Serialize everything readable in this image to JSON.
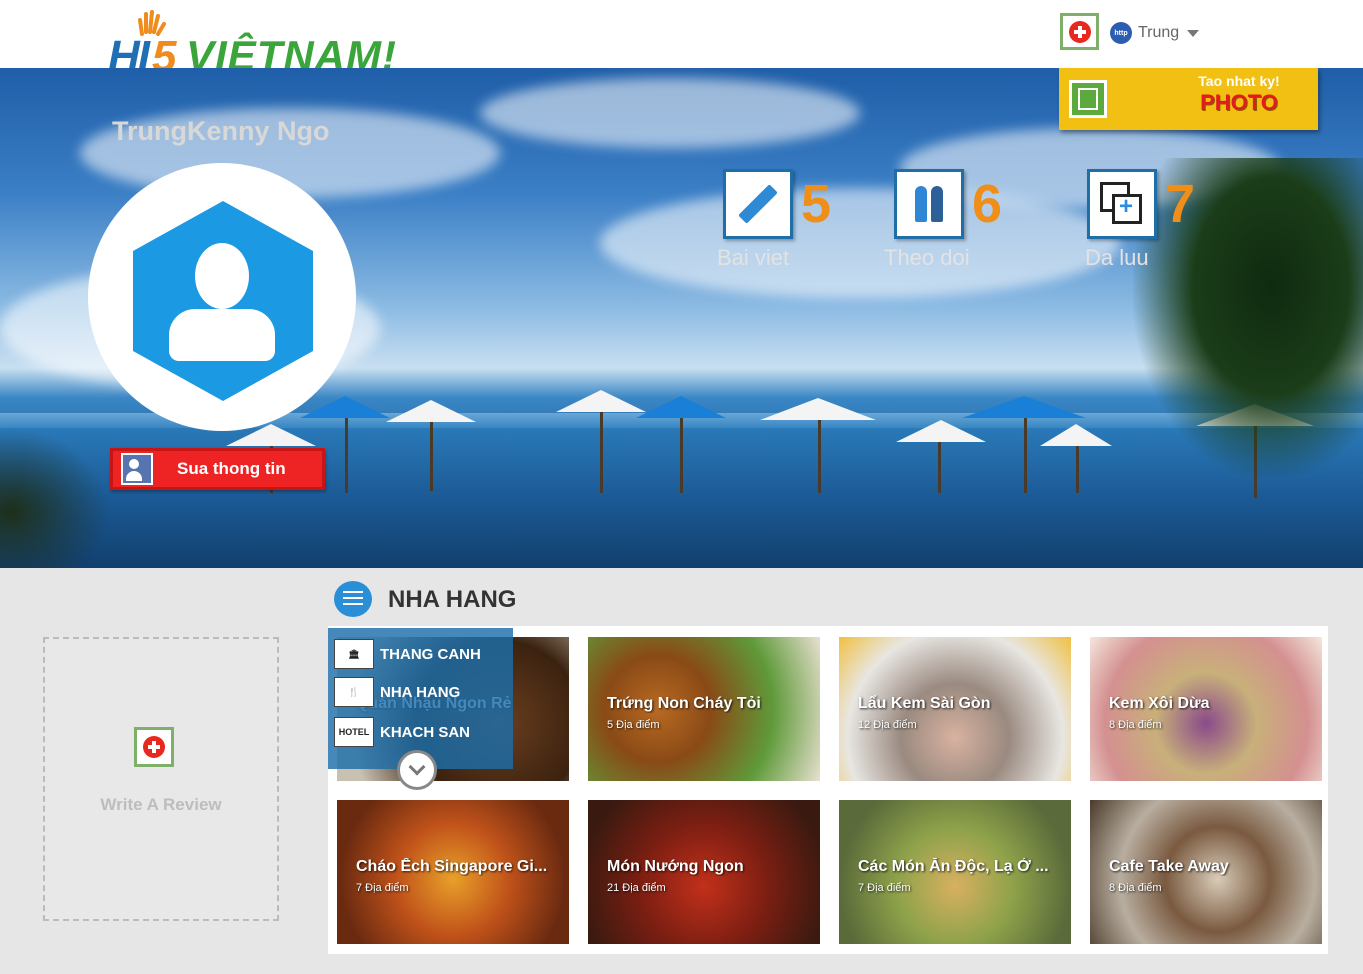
{
  "header": {
    "logo": {
      "text_hi": "HI",
      "text_5": "5",
      "text_vn": "VIỆTNAM!"
    },
    "user_name": "Trung",
    "user_icon_label": "http"
  },
  "profile": {
    "name": "TrungKenny Ngo",
    "edit_button": "Sua thong tin"
  },
  "diary": {
    "top_label": "Tao nhat ky!",
    "photo_label": "PHOTO"
  },
  "stats": [
    {
      "count": "5",
      "label": "Bai viet",
      "icon": "pencil-icon"
    },
    {
      "count": "6",
      "label": "Theo doi",
      "icon": "people-icon"
    },
    {
      "count": "7",
      "label": "Da luu",
      "icon": "saved-icon"
    }
  ],
  "sidebar": {
    "write_review": "Write A Review"
  },
  "section": {
    "title": "NHA HANG"
  },
  "category_menu": {
    "items": [
      {
        "label": "THANG CANH",
        "icon_text": "🏛"
      },
      {
        "label": "NHA HANG",
        "icon_text": "🍴"
      },
      {
        "label": "KHACH SAN",
        "icon_text": "HOTEL"
      }
    ]
  },
  "cards": [
    {
      "title": "Quán Nhậu Ngon Rẻ",
      "count": ""
    },
    {
      "title": "Trứng Non Cháy Tỏi",
      "count": "5 Địa điểm"
    },
    {
      "title": "Lẩu Kem Sài Gòn",
      "count": "12 Địa điểm"
    },
    {
      "title": "Kem Xôi Dừa",
      "count": "8 Địa điểm"
    },
    {
      "title": "Cháo Ếch Singapore Gi...",
      "count": "7 Địa điểm"
    },
    {
      "title": "Món Nướng Ngon",
      "count": "21 Địa điểm"
    },
    {
      "title": "Các Món Ăn Độc, Lạ Ở ...",
      "count": "7 Địa điểm"
    },
    {
      "title": "Cafe Take Away",
      "count": "8 Địa điểm"
    }
  ],
  "colors": {
    "accent_red": "#ee2424",
    "accent_yellow": "#f2c012",
    "stat_orange": "#f08e1a",
    "brand_blue": "#1b9ae3"
  }
}
